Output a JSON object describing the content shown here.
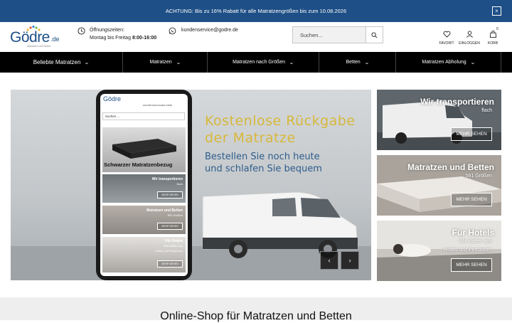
{
  "announcement": {
    "text": "ACHTUNG: Bis zu 16% Rabatt für alle Matratzengrößen bis zum 10.08.2026",
    "close_label": "×"
  },
  "header": {
    "logo_text": "Gödre",
    "logo_tld": ".de",
    "logo_tagline": "Matratzen und Betten",
    "hours_label": "Öffnungszeiten:",
    "hours_days": "Montag bis Freitag",
    "hours_time": "8:00-16:00",
    "email": "kundenservice@godre.de",
    "search_placeholder": "Suchen...",
    "favorit_label": "FAVORIT",
    "login_label": "EINLOGGEN",
    "cart_label": "KORB",
    "cart_count": "0"
  },
  "nav": {
    "items": [
      {
        "label": "Beliebte Matratzen"
      },
      {
        "label": "Matratzen"
      },
      {
        "label": "Matratzen nach Größen"
      },
      {
        "label": "Betten"
      },
      {
        "label": "Matratzen Abholung"
      }
    ]
  },
  "hero": {
    "headline_1": "Kostenlose Rückgabe",
    "headline_2": "der Matratze",
    "sub_1": "Bestellen Sie noch heute",
    "sub_2": "und schlafen Sie bequem",
    "prev_label": "‹",
    "next_label": "›",
    "phone": {
      "logo": "Gödre",
      "icons_text": "FAVORIT  EINLOGGEN  KORB",
      "search": "Suchen ...",
      "card1_caption": "Schwarzer Matratzenbezug",
      "card2_title": "Wir transportieren",
      "card2_sub": "flach",
      "card3_title": "Matratzen und Betten",
      "card3_sub": "591 Größen",
      "card4_title": "Für Hotels",
      "card4_sub1": "Wir statten aus",
      "card4_sub2": "Hotels und Pensionen",
      "btn": "MEHR SEHEN"
    }
  },
  "promos": [
    {
      "title": "Wir transportieren",
      "sub": "flach",
      "button": "MEHR SEHEN"
    },
    {
      "title": "Matratzen und Betten",
      "sub": "591 Größen",
      "button": "MEHR SEHEN"
    },
    {
      "title": "Für Hotels",
      "sub": "Wir statten aus",
      "sub2": "Hotels und Pensionen",
      "button": "MEHR SEHEN"
    }
  ],
  "section_title": "Online-Shop für Matratzen und Betten",
  "colors": {
    "brand_blue": "#1e4f86",
    "nav_bg": "#000000",
    "headline_gold": "#d7b83a"
  }
}
